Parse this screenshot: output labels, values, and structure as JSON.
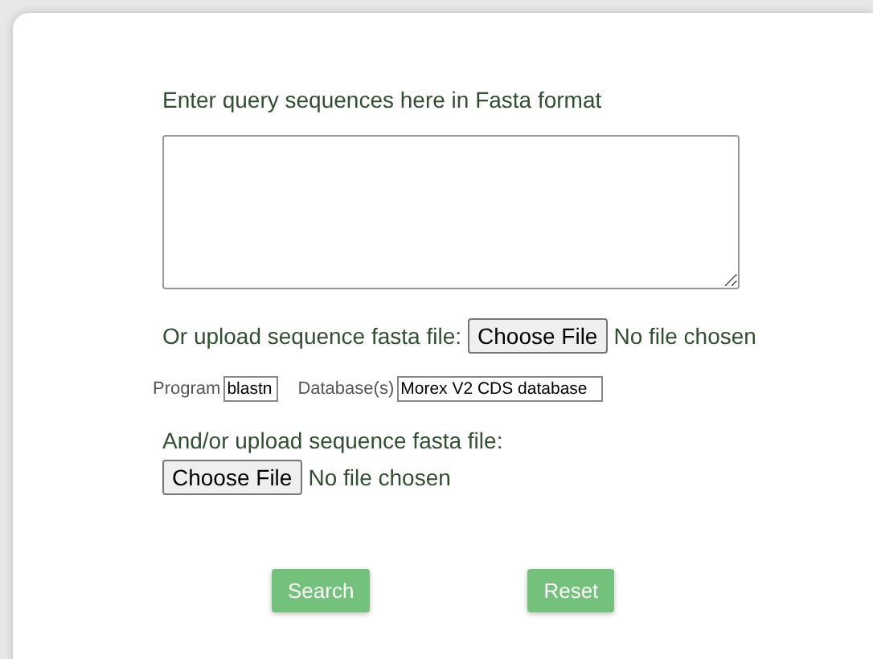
{
  "query": {
    "label": "Enter query sequences here in Fasta format"
  },
  "upload1": {
    "label": "Or upload sequence fasta file:",
    "button": "Choose File",
    "status": "No file chosen"
  },
  "program": {
    "label": "Program",
    "value": "blastn"
  },
  "database": {
    "label": "Database(s)",
    "value": "Morex V2 CDS database"
  },
  "upload2": {
    "label": "And/or upload sequence fasta file:",
    "button": "Choose File",
    "status": "No file chosen"
  },
  "buttons": [
    {
      "label": "Search"
    },
    {
      "label": "Reset"
    }
  ]
}
